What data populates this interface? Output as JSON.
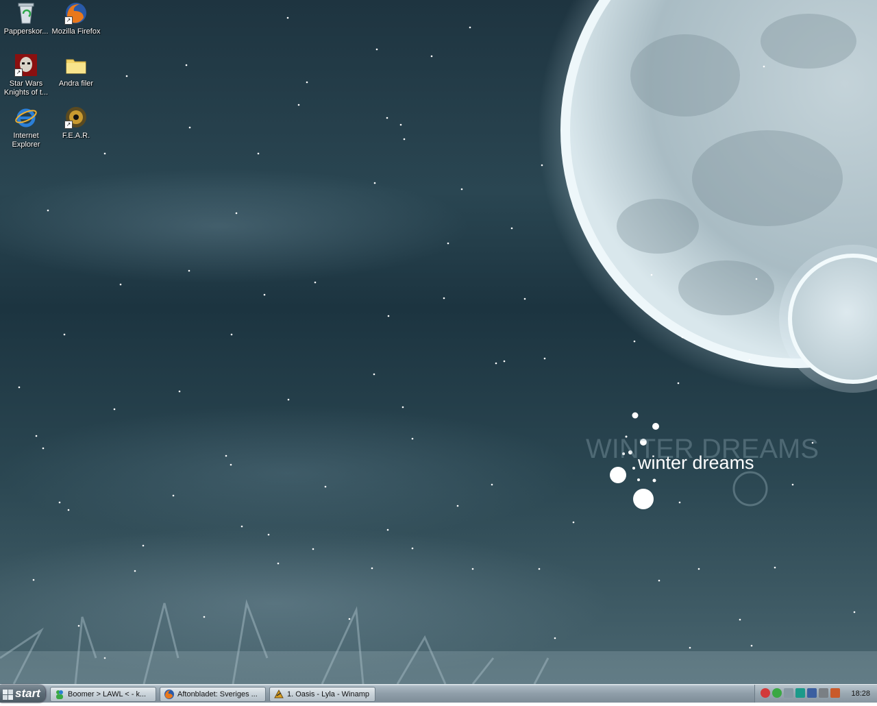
{
  "desktop": {
    "icons": [
      {
        "label": "Papperskor..."
      },
      {
        "label": "Mozilla Firefox"
      },
      {
        "label": "Star Wars Knights of t..."
      },
      {
        "label": "Andra filer"
      },
      {
        "label": "Internet Explorer"
      },
      {
        "label": "F.E.A.R."
      }
    ],
    "wallpaper": {
      "title": "winter dreams",
      "colors": {
        "sky_dark": "#1c3440",
        "moon": "#c9d8de",
        "glow": "#e8f4f8"
      }
    }
  },
  "taskbar": {
    "start_label": "start",
    "tasks": [
      {
        "label": "Boomer > LAWL < - k...",
        "icon": "msn-messenger-icon"
      },
      {
        "label": "Aftonbladet: Sveriges ...",
        "icon": "firefox-icon"
      },
      {
        "label": "1. Oasis - Lyla - Winamp",
        "icon": "winamp-icon"
      }
    ],
    "clock": "18:28"
  }
}
